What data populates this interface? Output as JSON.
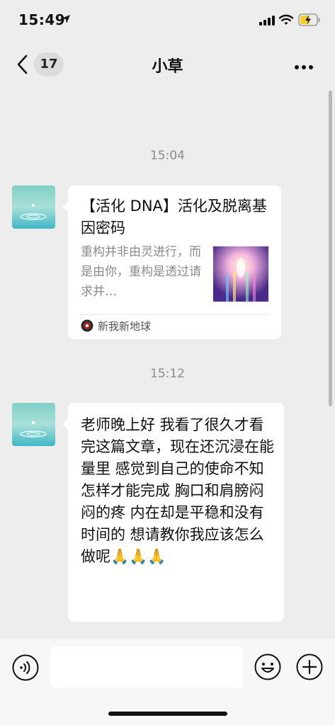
{
  "status_bar": {
    "time": "15:49"
  },
  "nav": {
    "unread_count": "17",
    "title": "小草"
  },
  "messages": [
    {
      "timestamp": "15:04",
      "card": {
        "title": "【活化 DNA】活化及脱离基因密码",
        "description": "重构并非由灵进行，而是由你，重构是透过请求并…",
        "source": "新我新地球"
      }
    },
    {
      "timestamp": "15:12",
      "text": "老师晚上好  我看了很久才看完这篇文章，现在还沉浸在能量里   感觉到自己的使命不知怎样才能完成   胸口和肩膀闷闷的疼   内在却是平稳和没有时间的  想请教你我应该怎么做呢🙏🙏🙏"
    }
  ],
  "input": {
    "placeholder": ""
  },
  "colors": {
    "background": "#ededed",
    "bubble": "#ffffff",
    "timestamp": "#8c8c8c",
    "battery": "#f5d02b"
  },
  "icons": [
    "location-arrow-icon",
    "signal-icon",
    "wifi-icon",
    "battery-charging-icon",
    "back-chevron-icon",
    "more-icon",
    "voice-icon",
    "emoji-icon",
    "plus-icon"
  ]
}
